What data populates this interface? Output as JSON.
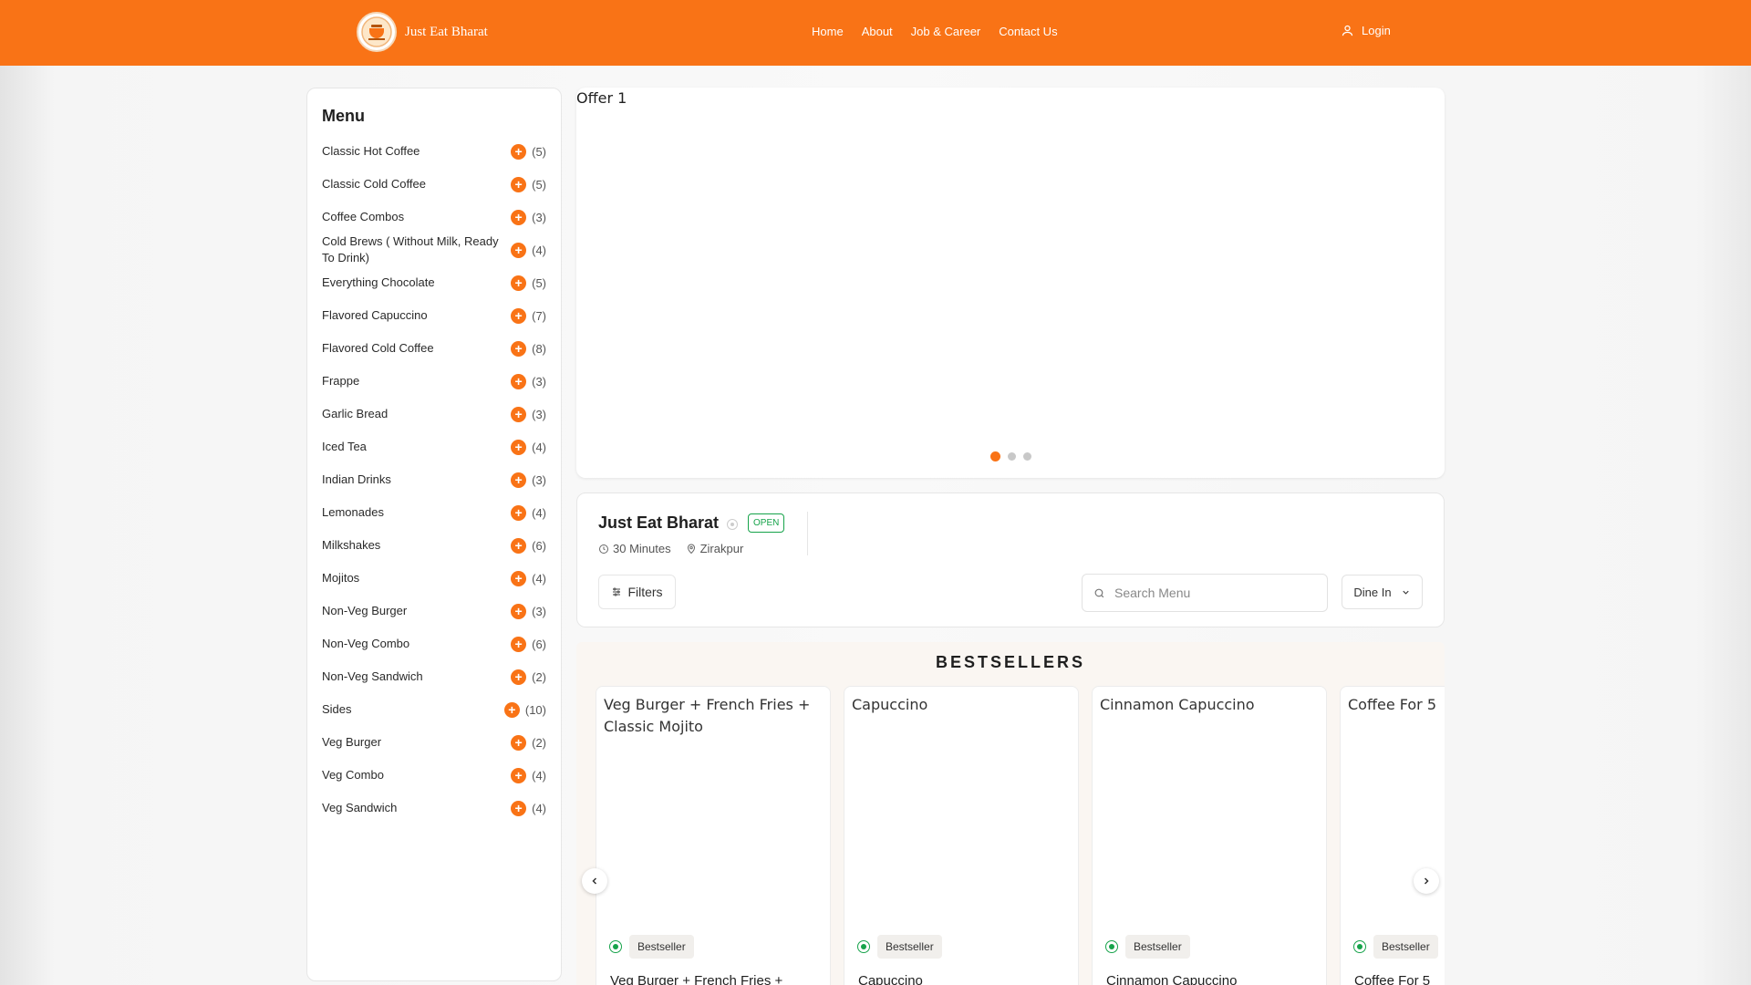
{
  "header": {
    "brand_name": "Just Eat Bharat",
    "nav": [
      "Home",
      "About",
      "Job & Career",
      "Contact Us"
    ],
    "login_label": "Login",
    "accent_color": "#f97316"
  },
  "sidebar": {
    "title": "Menu",
    "items": [
      {
        "label": "Classic Hot Coffee",
        "count": "(5)"
      },
      {
        "label": "Classic Cold Coffee",
        "count": "(5)"
      },
      {
        "label": "Coffee Combos",
        "count": "(3)"
      },
      {
        "label": "Cold Brews ( Without Milk, Ready To Drink)",
        "count": "(4)"
      },
      {
        "label": "Everything Chocolate",
        "count": "(5)"
      },
      {
        "label": "Flavored Capuccino",
        "count": "(7)"
      },
      {
        "label": "Flavored Cold Coffee",
        "count": "(8)"
      },
      {
        "label": "Frappe",
        "count": "(3)"
      },
      {
        "label": "Garlic Bread",
        "count": "(3)"
      },
      {
        "label": "Iced Tea",
        "count": "(4)"
      },
      {
        "label": "Indian Drinks",
        "count": "(3)"
      },
      {
        "label": "Lemonades",
        "count": "(4)"
      },
      {
        "label": "Milkshakes",
        "count": "(6)"
      },
      {
        "label": "Mojitos",
        "count": "(4)"
      },
      {
        "label": "Non-Veg Burger",
        "count": "(3)"
      },
      {
        "label": "Non-Veg Combo",
        "count": "(6)"
      },
      {
        "label": "Non-Veg Sandwich",
        "count": "(2)"
      },
      {
        "label": "Sides",
        "count": "(10)"
      },
      {
        "label": "Veg Burger",
        "count": "(2)"
      },
      {
        "label": "Veg Combo",
        "count": "(4)"
      },
      {
        "label": "Veg Sandwich",
        "count": "(4)"
      }
    ]
  },
  "banner": {
    "image_alt": "Offer 1",
    "slides": 3,
    "active_slide": 1
  },
  "restaurant": {
    "name": "Just Eat Bharat",
    "status": "OPEN",
    "delivery_time": "30 Minutes",
    "location": "Zirakpur",
    "filters_label": "Filters",
    "search_placeholder": "Search Menu",
    "service_mode": "Dine In"
  },
  "bestsellers": {
    "title": "BESTSELLERS",
    "items": [
      {
        "image_alt": "Veg Burger + French Fries + Classic Mojito",
        "tag": "Bestseller",
        "name": "Veg Burger + French Fries +"
      },
      {
        "image_alt": "Capuccino",
        "tag": "Bestseller",
        "name": "Capuccino"
      },
      {
        "image_alt": "Cinnamon Capuccino",
        "tag": "Bestseller",
        "name": "Cinnamon Capuccino"
      },
      {
        "image_alt": "Coffee For 5",
        "tag": "Bestseller",
        "name": "Coffee For 5"
      }
    ]
  },
  "icons": {
    "user": "user-icon",
    "clock": "clock-icon",
    "location": "map-pin-icon",
    "filters": "sliders-icon",
    "search": "search-icon",
    "chevron": "chevron-down-icon",
    "veg": "veg-icon",
    "prev": "chevron-left-icon",
    "next": "chevron-right-icon"
  },
  "colors": {
    "accent": "#f97316",
    "veg_green": "#16a34a"
  }
}
